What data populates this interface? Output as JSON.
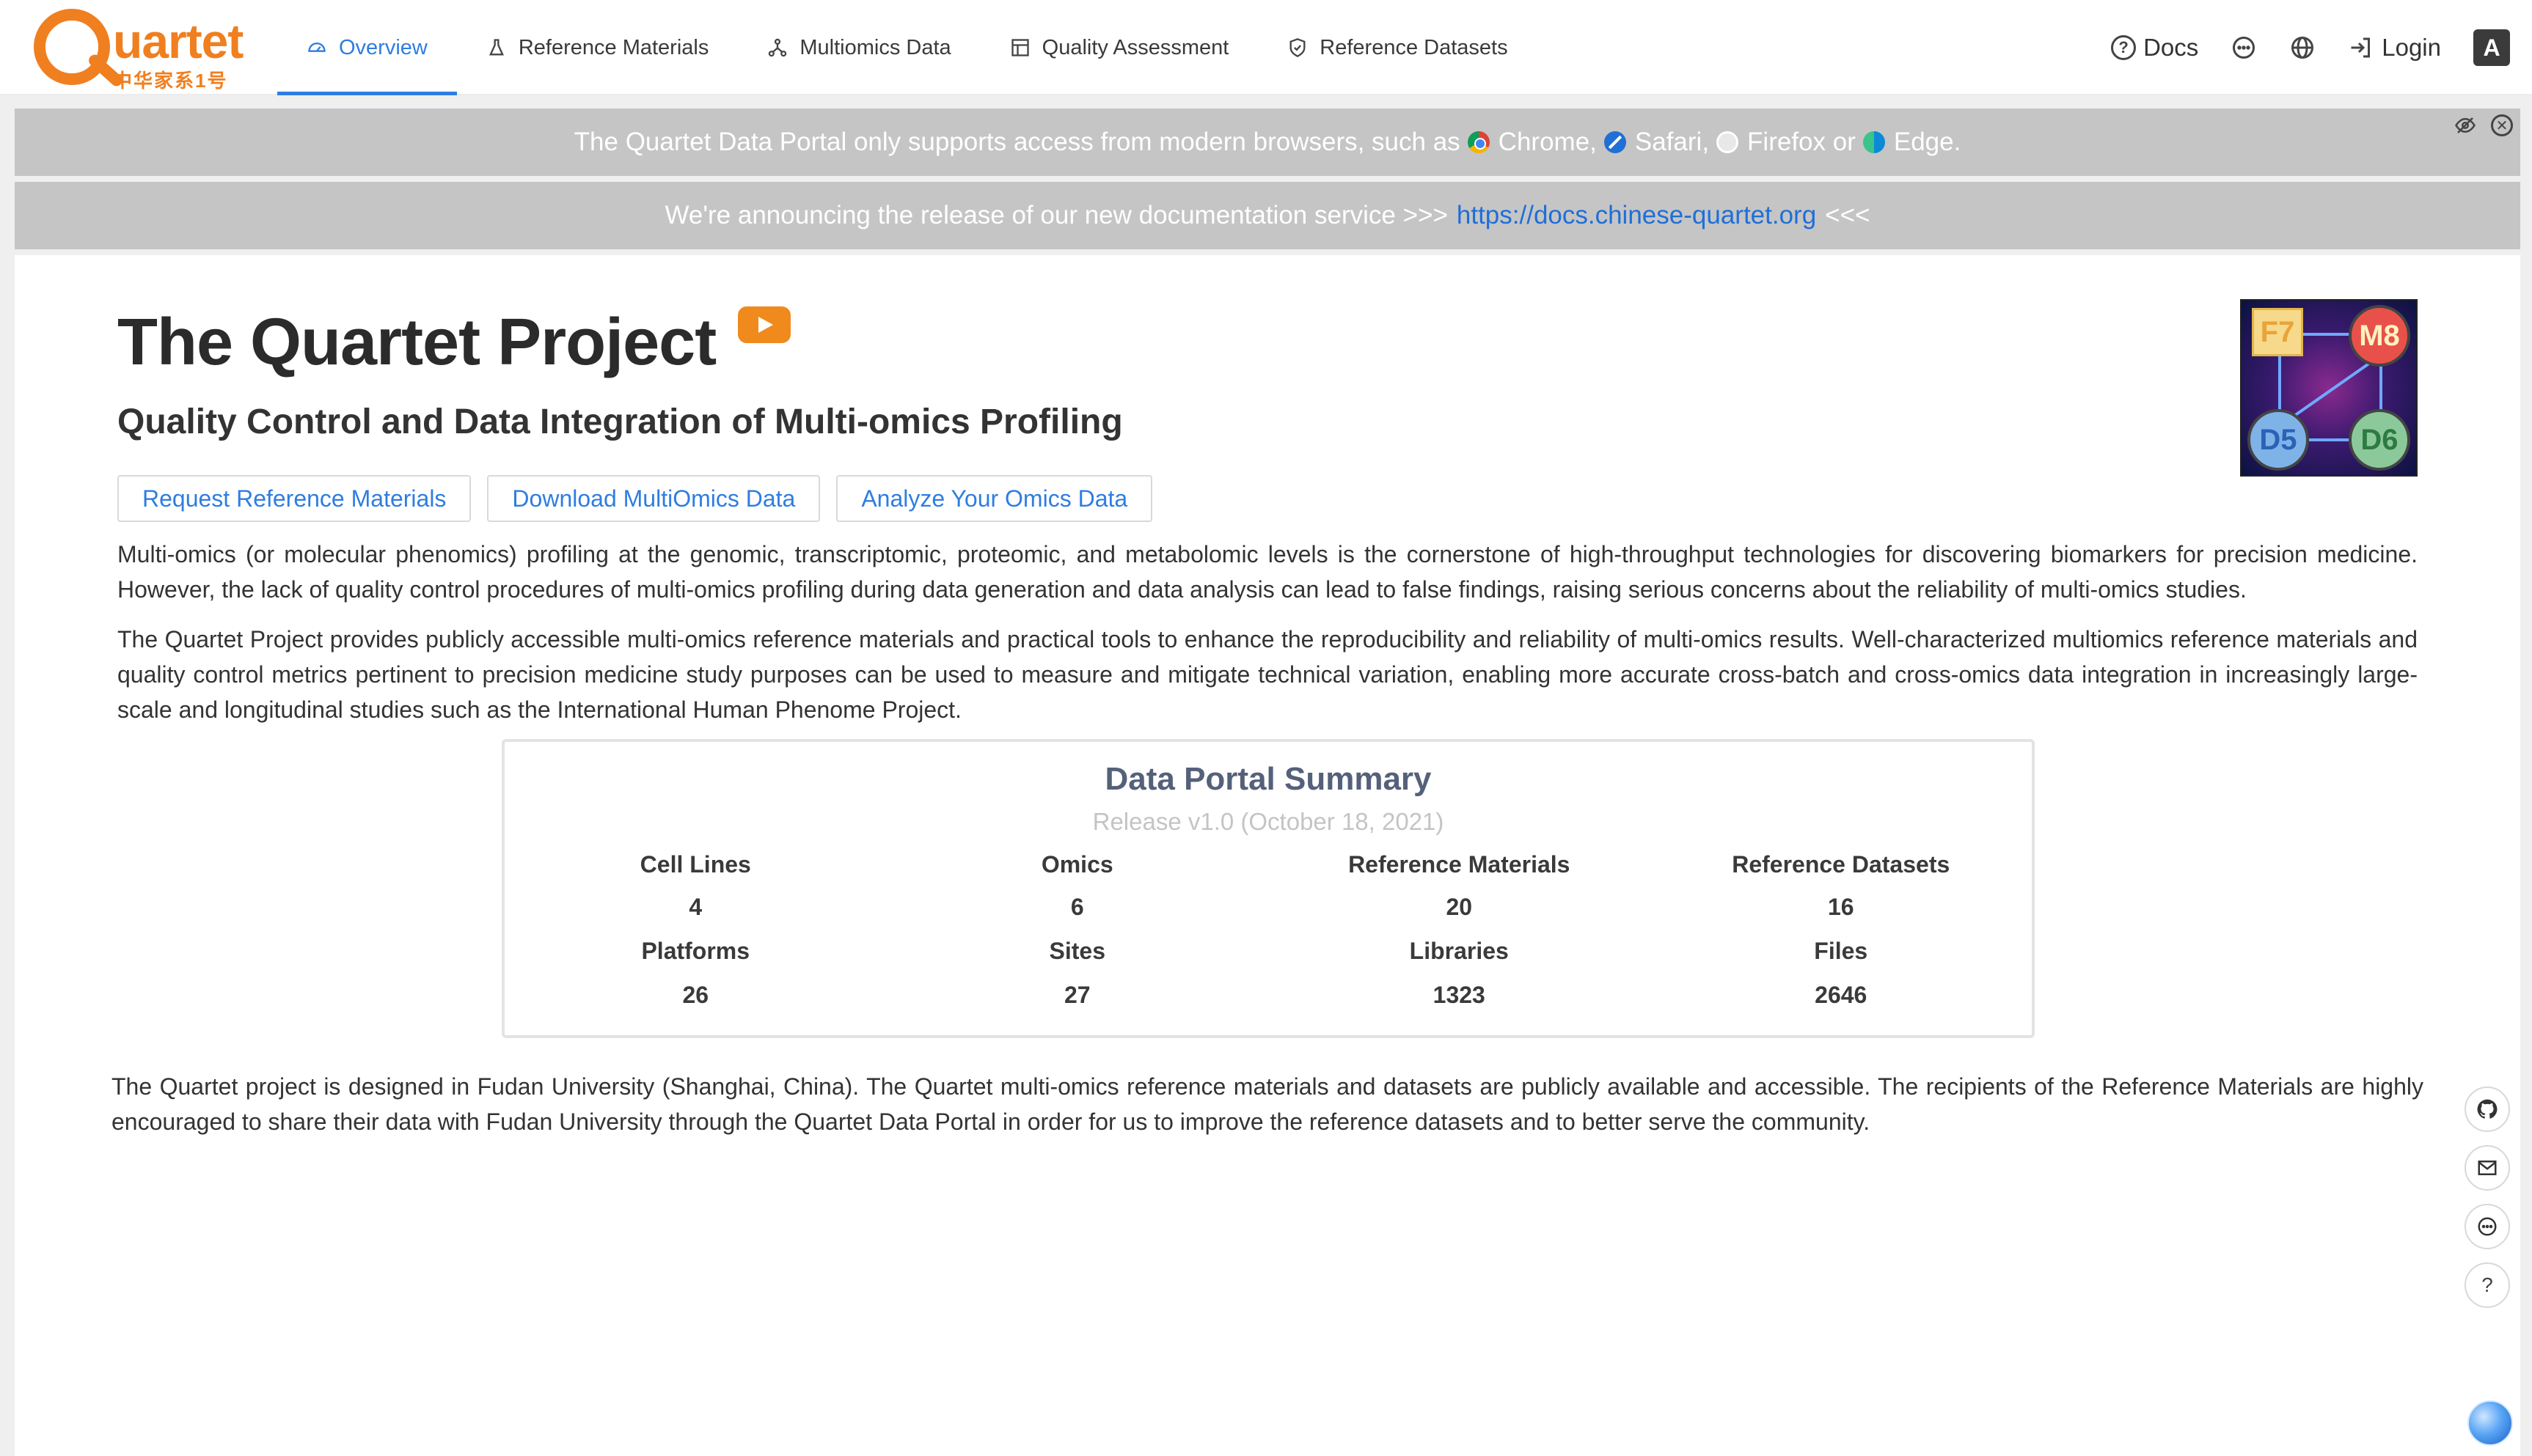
{
  "nav": {
    "logo_word": "uartet",
    "logo_cn": "中华家系1号",
    "tabs": [
      {
        "label": "Overview",
        "icon": "dashboard-icon",
        "active": true
      },
      {
        "label": "Reference Materials",
        "icon": "flask-icon",
        "active": false
      },
      {
        "label": "Multiomics Data",
        "icon": "network-icon",
        "active": false
      },
      {
        "label": "Quality Assessment",
        "icon": "table-icon",
        "active": false
      },
      {
        "label": "Reference Datasets",
        "icon": "shield-icon",
        "active": false
      }
    ],
    "docs_label": "Docs",
    "login_label": "Login",
    "app_icon_glyph": "A"
  },
  "banners": {
    "browser_prefix": "The Quartet Data Portal only supports access from modern browsers, such as",
    "chrome": "Chrome,",
    "safari": "Safari,",
    "firefox": "Firefox or",
    "edge": "Edge.",
    "docs_prefix": "We're announcing the release of our new documentation service >>>",
    "docs_link": "https://docs.chinese-quartet.org",
    "docs_suffix": "<<<"
  },
  "hero": {
    "title": "The Quartet Project",
    "subtitle": "Quality Control and Data Integration of Multi-omics Profiling",
    "logo_labels": {
      "f7": "F7",
      "m8": "M8",
      "d5": "D5",
      "d6": "D6"
    },
    "buttons": [
      "Request Reference Materials",
      "Download MultiOmics Data",
      "Analyze Your Omics Data"
    ]
  },
  "paragraphs": {
    "p1": "Multi-omics (or molecular phenomics) profiling at the genomic, transcriptomic, proteomic, and metabolomic levels is the cornerstone of high-throughput technologies for discovering biomarkers for precision medicine. However, the lack of quality control procedures of multi-omics profiling during data generation and data analysis can lead to false findings, raising serious concerns about the reliability of multi-omics studies.",
    "p2": "The Quartet Project provides publicly accessible multi-omics reference materials and practical tools to enhance the reproducibility and reliability of multi-omics results. Well-characterized multiomics reference materials and quality control metrics pertinent to precision medicine study purposes can be used to measure and mitigate technical variation, enabling more accurate cross-batch and cross-omics data integration in increasingly large-scale and longitudinal studies such as the International Human Phenome Project.",
    "p3": "The Quartet project is designed in Fudan University (Shanghai, China). The Quartet multi-omics reference materials and datasets are publicly available and accessible. The recipients of the Reference Materials are highly encouraged to share their data with Fudan University through the Quartet Data Portal in order for us to improve the reference datasets and to better serve the community."
  },
  "summary": {
    "title": "Data Portal Summary",
    "release": "Release v1.0 (October 18, 2021)",
    "stats": [
      {
        "label": "Cell Lines",
        "value": "4"
      },
      {
        "label": "Omics",
        "value": "6"
      },
      {
        "label": "Reference Materials",
        "value": "20"
      },
      {
        "label": "Reference Datasets",
        "value": "16"
      },
      {
        "label": "Platforms",
        "value": "26"
      },
      {
        "label": "Sites",
        "value": "27"
      },
      {
        "label": "Libraries",
        "value": "1323"
      },
      {
        "label": "Files",
        "value": "2646"
      }
    ]
  },
  "side_buttons": [
    "github-icon",
    "mail-icon",
    "chat-icon",
    "help-icon"
  ],
  "colors": {
    "brand_orange": "#f07f1f",
    "accent_blue": "#2f7de1",
    "banner_gray": "#c5c5c5"
  }
}
